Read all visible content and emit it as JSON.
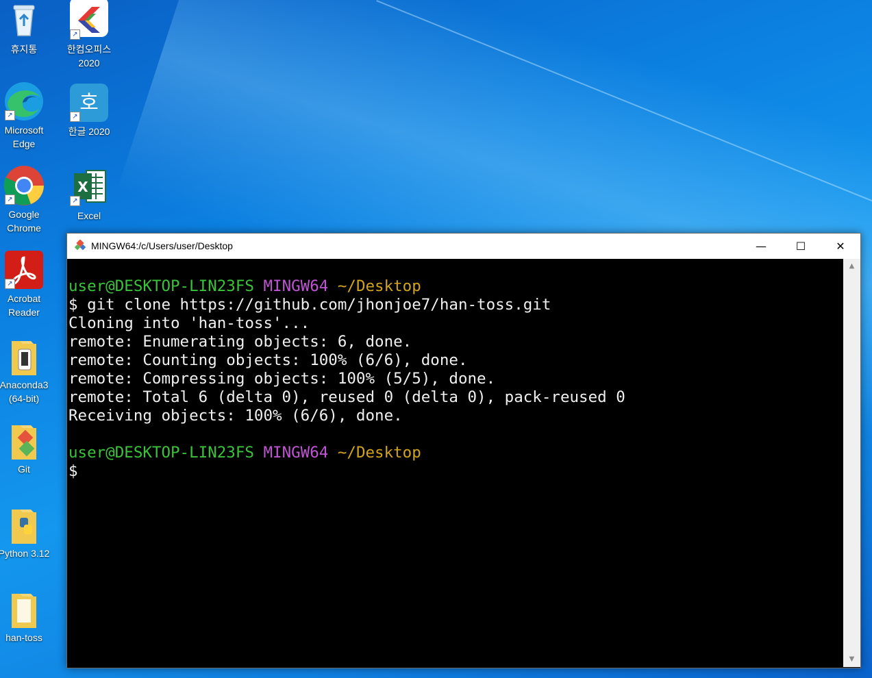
{
  "desktop": {
    "icons": [
      {
        "label": "휴지통"
      },
      {
        "label": "한컴오피스\n2020"
      },
      {
        "label": "Microsoft\nEdge"
      },
      {
        "label": "한글 2020"
      },
      {
        "label": "Google\nChrome"
      },
      {
        "label": "Excel"
      },
      {
        "label": "Acrobat\nReader"
      },
      {
        "label": "Anaconda3\n(64-bit)"
      },
      {
        "label": "Git"
      },
      {
        "label": "Python 3.12"
      },
      {
        "label": "han-toss"
      }
    ]
  },
  "window": {
    "title": "MINGW64:/c/Users/user/Desktop",
    "minimize": "—",
    "maximize": "☐",
    "close": "✕"
  },
  "terminal": {
    "prompt_user": "user@DESKTOP-LIN23FS",
    "prompt_env": "MINGW64",
    "prompt_path": "~/Desktop",
    "command": "$ git clone https://github.com/jhonjoe7/han-toss.git",
    "output": [
      "Cloning into 'han-toss'...",
      "remote: Enumerating objects: 6, done.",
      "remote: Counting objects: 100% (6/6), done.",
      "remote: Compressing objects: 100% (5/5), done.",
      "remote: Total 6 (delta 0), reused 0 (delta 0), pack-reused 0",
      "Receiving objects: 100% (6/6), done."
    ],
    "cursor_prompt": "$"
  },
  "colors": {
    "prompt_user": "#3ac43a",
    "prompt_env": "#c054d4",
    "prompt_path": "#d4a418"
  }
}
